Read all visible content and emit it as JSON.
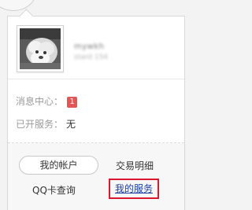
{
  "profile": {
    "nickname": "mywkh",
    "account": "stard 154",
    "avatar_icon": "dog-photo-avatar-icon"
  },
  "info": {
    "messages_label": "消息中心：",
    "messages_count": "1",
    "services_label": "已开服务：",
    "services_value": "无"
  },
  "actions": {
    "my_account": "我的帐户",
    "transactions": "交易明细",
    "qq_card": "QQ卡查询",
    "my_services": "我的服务"
  },
  "colors": {
    "badge": "#e45656",
    "highlight_border": "#d9182d",
    "link": "#1a3fa8"
  }
}
